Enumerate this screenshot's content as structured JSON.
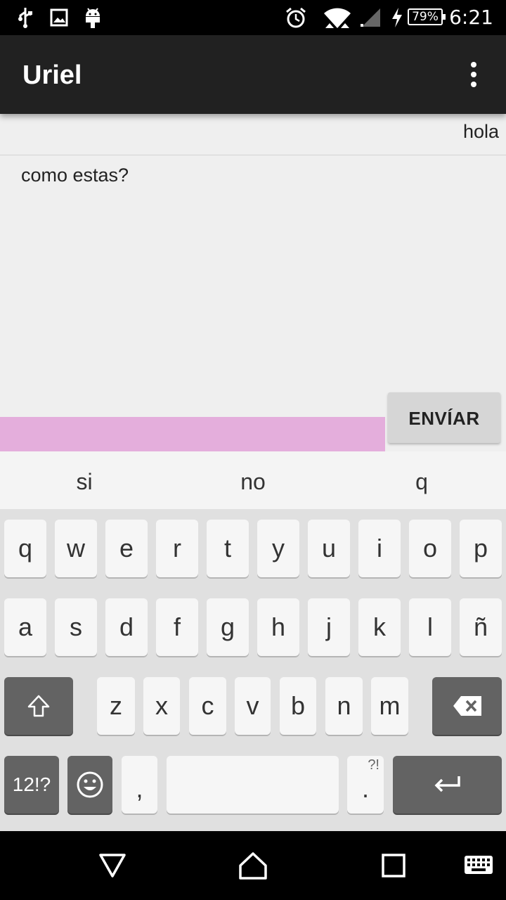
{
  "status_bar": {
    "icons": [
      "usb-icon",
      "image-icon",
      "android-icon",
      "alarm-icon",
      "wifi-icon",
      "signal-icon",
      "charging-icon"
    ],
    "battery": "79%",
    "time": "6:21"
  },
  "app_bar": {
    "title": "Uriel",
    "menu_icon": "more-vert-icon"
  },
  "chat": {
    "messages": [
      {
        "text": "hola",
        "side": "right"
      },
      {
        "text": "como estas?",
        "side": "left"
      }
    ]
  },
  "composer": {
    "input_value": "",
    "input_color": "#e4aedc",
    "send_label": "ENVÍAR"
  },
  "suggestions": [
    "si",
    "no",
    "q"
  ],
  "keyboard": {
    "row1": [
      "q",
      "w",
      "e",
      "r",
      "t",
      "y",
      "u",
      "i",
      "o",
      "p"
    ],
    "row2": [
      "a",
      "s",
      "d",
      "f",
      "g",
      "h",
      "j",
      "k",
      "l",
      "ñ"
    ],
    "row3": [
      "z",
      "x",
      "c",
      "v",
      "b",
      "n",
      "m"
    ],
    "symbols_label": "12!?",
    "comma": ",",
    "period": ".",
    "period_hint": "?!"
  },
  "nav_bar": {
    "icons": [
      "back-icon",
      "home-icon",
      "recents-icon",
      "keyboard-icon"
    ]
  }
}
